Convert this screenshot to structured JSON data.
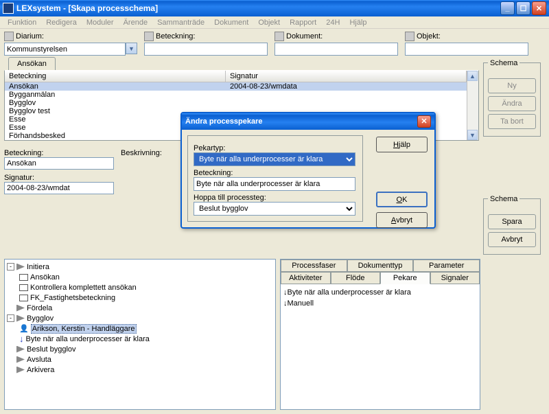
{
  "window": {
    "title": "LEXsystem - [Skapa processchema]"
  },
  "menus": [
    "Funktion",
    "Redigera",
    "Moduler",
    "Ärende",
    "Sammanträde",
    "Dokument",
    "Objekt",
    "Rapport",
    "24H",
    "Hjälp"
  ],
  "top_fields": {
    "diarium": {
      "label": "Diarium:",
      "value": "Kommunstyrelsen"
    },
    "beteckning": {
      "label": "Beteckning:",
      "value": ""
    },
    "dokument": {
      "label": "Dokument:",
      "value": ""
    },
    "objekt": {
      "label": "Objekt:",
      "value": ""
    }
  },
  "tab_main": "Ansökan",
  "grid": {
    "columns": [
      "Beteckning",
      "Signatur"
    ],
    "rows": [
      {
        "beteckning": "Ansökan",
        "signatur": "2004-08-23/wmdata",
        "sel": true
      },
      {
        "beteckning": "Bygganmälan",
        "signatur": "",
        "sel": false
      },
      {
        "beteckning": "Bygglov",
        "signatur": "",
        "sel": false
      },
      {
        "beteckning": "Bygglov test",
        "signatur": "",
        "sel": false
      },
      {
        "beteckning": "Esse",
        "signatur": "",
        "sel": false
      },
      {
        "beteckning": "Esse",
        "signatur": "",
        "sel": false
      },
      {
        "beteckning": "Förhandsbesked",
        "signatur": "",
        "sel": false
      }
    ]
  },
  "details": {
    "beteckning_label": "Beteckning:",
    "beteckning_value": "Ansökan",
    "signatur_label": "Signatur:",
    "signatur_value": "2004-08-23/wmdat",
    "beskrivning_label": "Beskrivning:"
  },
  "schema_top": {
    "title": "Schema",
    "ny": "Ny",
    "andra": "Ändra",
    "tabort": "Ta bort"
  },
  "schema_bottom": {
    "title": "Schema",
    "spara": "Spara",
    "avbryt": "Avbryt"
  },
  "tree": [
    {
      "level": 0,
      "exp": "-",
      "icon": "tri",
      "text": "Initiera"
    },
    {
      "level": 1,
      "icon": "box",
      "text": "Ansökan"
    },
    {
      "level": 1,
      "icon": "box",
      "text": "Kontrollera komplettett ansökan"
    },
    {
      "level": 1,
      "icon": "box",
      "text": "FK_Fastighetsbeteckning"
    },
    {
      "level": 0,
      "icon": "tri",
      "text": "Fördela"
    },
    {
      "level": 0,
      "exp": "-",
      "icon": "tri",
      "text": "Bygglov"
    },
    {
      "level": 1,
      "icon": "person",
      "text": "Arikson, Kerstin - Handläggare",
      "sel": true
    },
    {
      "level": 1,
      "icon": "arrow",
      "text": "Byte när alla underprocesser är klara"
    },
    {
      "level": 0,
      "icon": "tri",
      "text": "Beslut bygglov"
    },
    {
      "level": 0,
      "icon": "tri",
      "text": "Avsluta"
    },
    {
      "level": 0,
      "icon": "tri",
      "text": "Arkivera"
    }
  ],
  "tabs": {
    "row1": [
      "Processfaser",
      "Dokumenttyp",
      "Parameter"
    ],
    "row2": [
      "Aktiviteter",
      "Flöde",
      "Pekare",
      "Signaler"
    ],
    "active": "Pekare",
    "items": [
      {
        "icon": "arrow",
        "text": "Byte när alla underprocesser är klara"
      },
      {
        "icon": "arrow",
        "text": "Manuell"
      }
    ]
  },
  "dialog": {
    "title": "Ändra processpekare",
    "pekartyp_label": "Pekartyp:",
    "pekartyp_value": "Byte när alla underprocesser är klara",
    "beteckning_label": "Beteckning:",
    "beteckning_value": "Byte när alla underprocesser är klara",
    "hoppa_label": "Hoppa till processteg:",
    "hoppa_value": "Beslut bygglov",
    "btn_help": "Hjälp",
    "btn_ok": "OK",
    "btn_cancel": "Avbryt"
  }
}
